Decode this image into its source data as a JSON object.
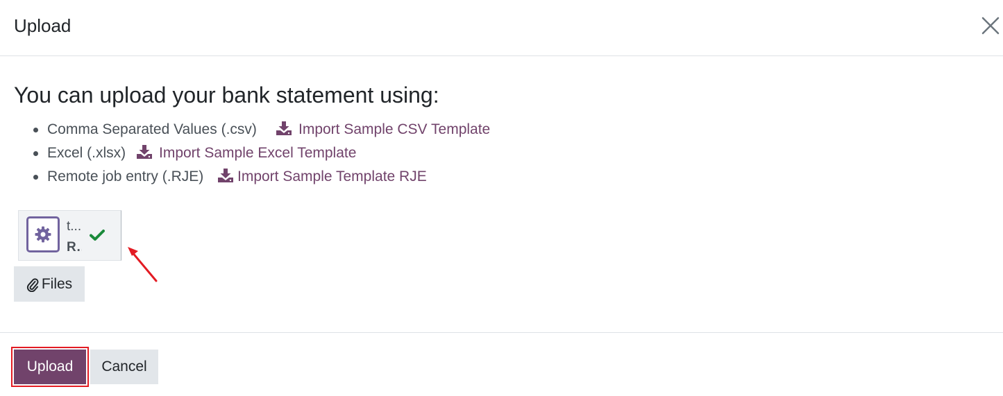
{
  "dialog": {
    "title": "Upload",
    "close_icon": "close-icon"
  },
  "body": {
    "heading": "You can upload your bank statement using:",
    "formats": [
      {
        "label": "Comma Separated Values (.csv)",
        "link": "Import Sample CSV Template",
        "icon": "download-icon"
      },
      {
        "label": "Excel (.xlsx)",
        "link": "Import Sample Excel Template",
        "icon": "download-icon"
      },
      {
        "label": "Remote job entry (.RJE)",
        "link": "Import Sample Template RJE",
        "icon": "download-icon"
      }
    ],
    "attachment": {
      "name": "t...",
      "ext": "R...",
      "file_icon": "gear-icon",
      "status_icon": "check-icon",
      "status_color": "#1a8a3a"
    },
    "files_button": {
      "label": "Files",
      "icon": "paperclip-icon"
    }
  },
  "footer": {
    "upload_label": "Upload",
    "cancel_label": "Cancel"
  },
  "colors": {
    "accent": "#71436b",
    "file_icon": "#71639e",
    "annotation": "#e31b23"
  }
}
